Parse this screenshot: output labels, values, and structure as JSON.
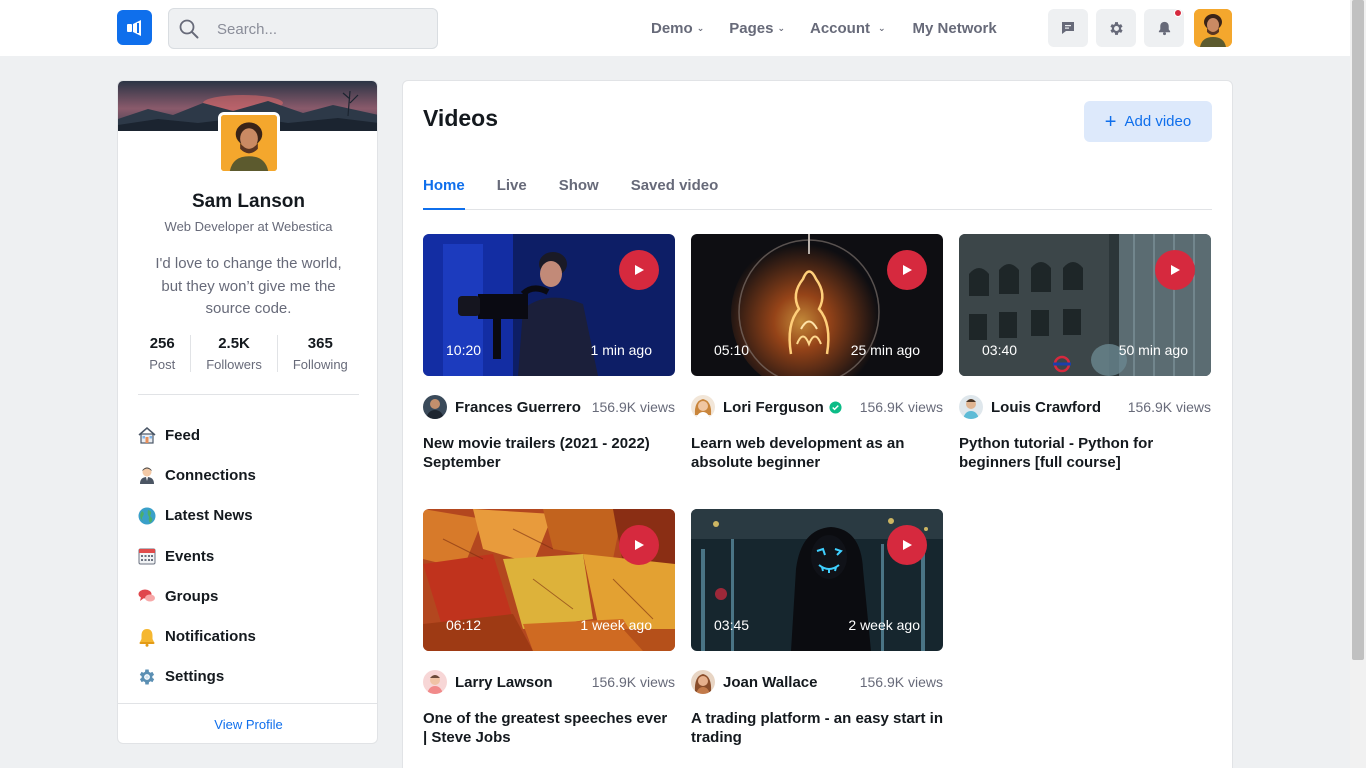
{
  "navbar": {
    "search_placeholder": "Search...",
    "links": [
      {
        "label": "Demo",
        "has_dropdown": true
      },
      {
        "label": "Pages",
        "has_dropdown": true
      },
      {
        "label": "Account",
        "has_dropdown": true
      },
      {
        "label": "My Network",
        "has_dropdown": false
      }
    ],
    "icons": [
      "chat-icon",
      "gear-icon",
      "bell-icon"
    ],
    "accent": "#0f6fec",
    "notification_dot_color": "#d6293e"
  },
  "profile": {
    "name": "Sam Lanson",
    "role": "Web Developer at Webestica",
    "quote": "I'd love to change the world, but they won’t give me the source code.",
    "stats": [
      {
        "value": "256",
        "label": "Post"
      },
      {
        "value": "2.5K",
        "label": "Followers"
      },
      {
        "value": "365",
        "label": "Following"
      }
    ],
    "menu": [
      {
        "label": "Feed",
        "icon": "home-icon"
      },
      {
        "label": "Connections",
        "icon": "person-icon"
      },
      {
        "label": "Latest News",
        "icon": "globe-icon"
      },
      {
        "label": "Events",
        "icon": "calendar-icon"
      },
      {
        "label": "Groups",
        "icon": "chat-bubbles-icon"
      },
      {
        "label": "Notifications",
        "icon": "bell-icon"
      },
      {
        "label": "Settings",
        "icon": "gear-icon"
      }
    ],
    "view_profile": "View Profile"
  },
  "main": {
    "title": "Videos",
    "add_button": "Add video",
    "tabs": [
      {
        "label": "Home",
        "active": true
      },
      {
        "label": "Live",
        "active": false
      },
      {
        "label": "Show",
        "active": false
      },
      {
        "label": "Saved video",
        "active": false
      }
    ],
    "videos": [
      {
        "duration": "10:20",
        "ago": "1 min ago",
        "author": "Frances Guerrero",
        "verified": false,
        "views": "156.9K views",
        "title": "New movie trailers (2021 - 2022) September"
      },
      {
        "duration": "05:10",
        "ago": "25 min ago",
        "author": "Lori Ferguson",
        "verified": true,
        "views": "156.9K views",
        "title": "Learn web development as an absolute beginner"
      },
      {
        "duration": "03:40",
        "ago": "50 min ago",
        "author": "Louis Crawford",
        "verified": false,
        "views": "156.9K views",
        "title": "Python tutorial - Python for beginners [full course]"
      },
      {
        "duration": "06:12",
        "ago": "1 week ago",
        "author": "Larry Lawson",
        "verified": false,
        "views": "156.9K views",
        "title": "One of the greatest speeches ever | Steve Jobs"
      },
      {
        "duration": "03:45",
        "ago": "2 week ago",
        "author": "Joan Wallace",
        "verified": false,
        "views": "156.9K views",
        "title": "A trading platform - an easy start in trading"
      }
    ]
  }
}
